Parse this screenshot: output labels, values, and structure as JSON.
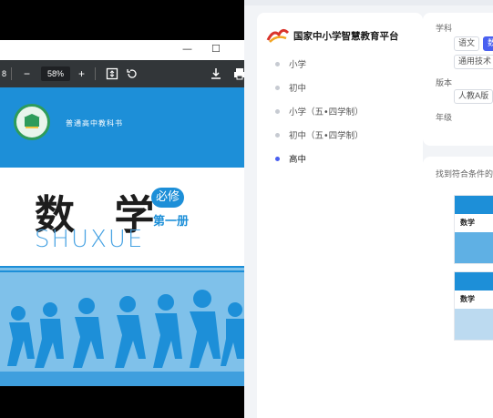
{
  "pdf_viewer": {
    "page_number_partial": "8",
    "zoom_out": "−",
    "zoom_level": "58%",
    "zoom_in": "+",
    "window_min": "—",
    "window_max": "☐",
    "book": {
      "series": "普通高中教科书",
      "title": "数 学",
      "pinyin": "SHUXUE",
      "tag": "必修",
      "volume": "第一册"
    }
  },
  "platform": {
    "brand_name": "国家中小学智慧教育平台",
    "nav_items": [
      {
        "label": "小学",
        "active": false
      },
      {
        "label": "初中",
        "active": false
      },
      {
        "label": "小学（五•四学制）",
        "active": false
      },
      {
        "label": "初中（五•四学制）",
        "active": false
      },
      {
        "label": "高中",
        "active": true
      }
    ],
    "info_icon": "i",
    "filters": {
      "subject_label": "学科",
      "subject_chips": [
        {
          "label": "语文",
          "selected": false
        },
        {
          "label": "数",
          "selected": true
        },
        {
          "label": "通用技术",
          "selected": false
        }
      ],
      "edition_label": "版本",
      "edition_chips": [
        {
          "label": "人教A版",
          "selected": false
        }
      ],
      "grade_label": "年级"
    },
    "results_label": "找到符合条件的",
    "result_thumbs": [
      {
        "title": "数学"
      },
      {
        "title": "数学"
      }
    ]
  },
  "colors": {
    "accent": "#4a60f0",
    "book_blue": "#1d8fd8",
    "book_green": "#2e9c5b"
  }
}
